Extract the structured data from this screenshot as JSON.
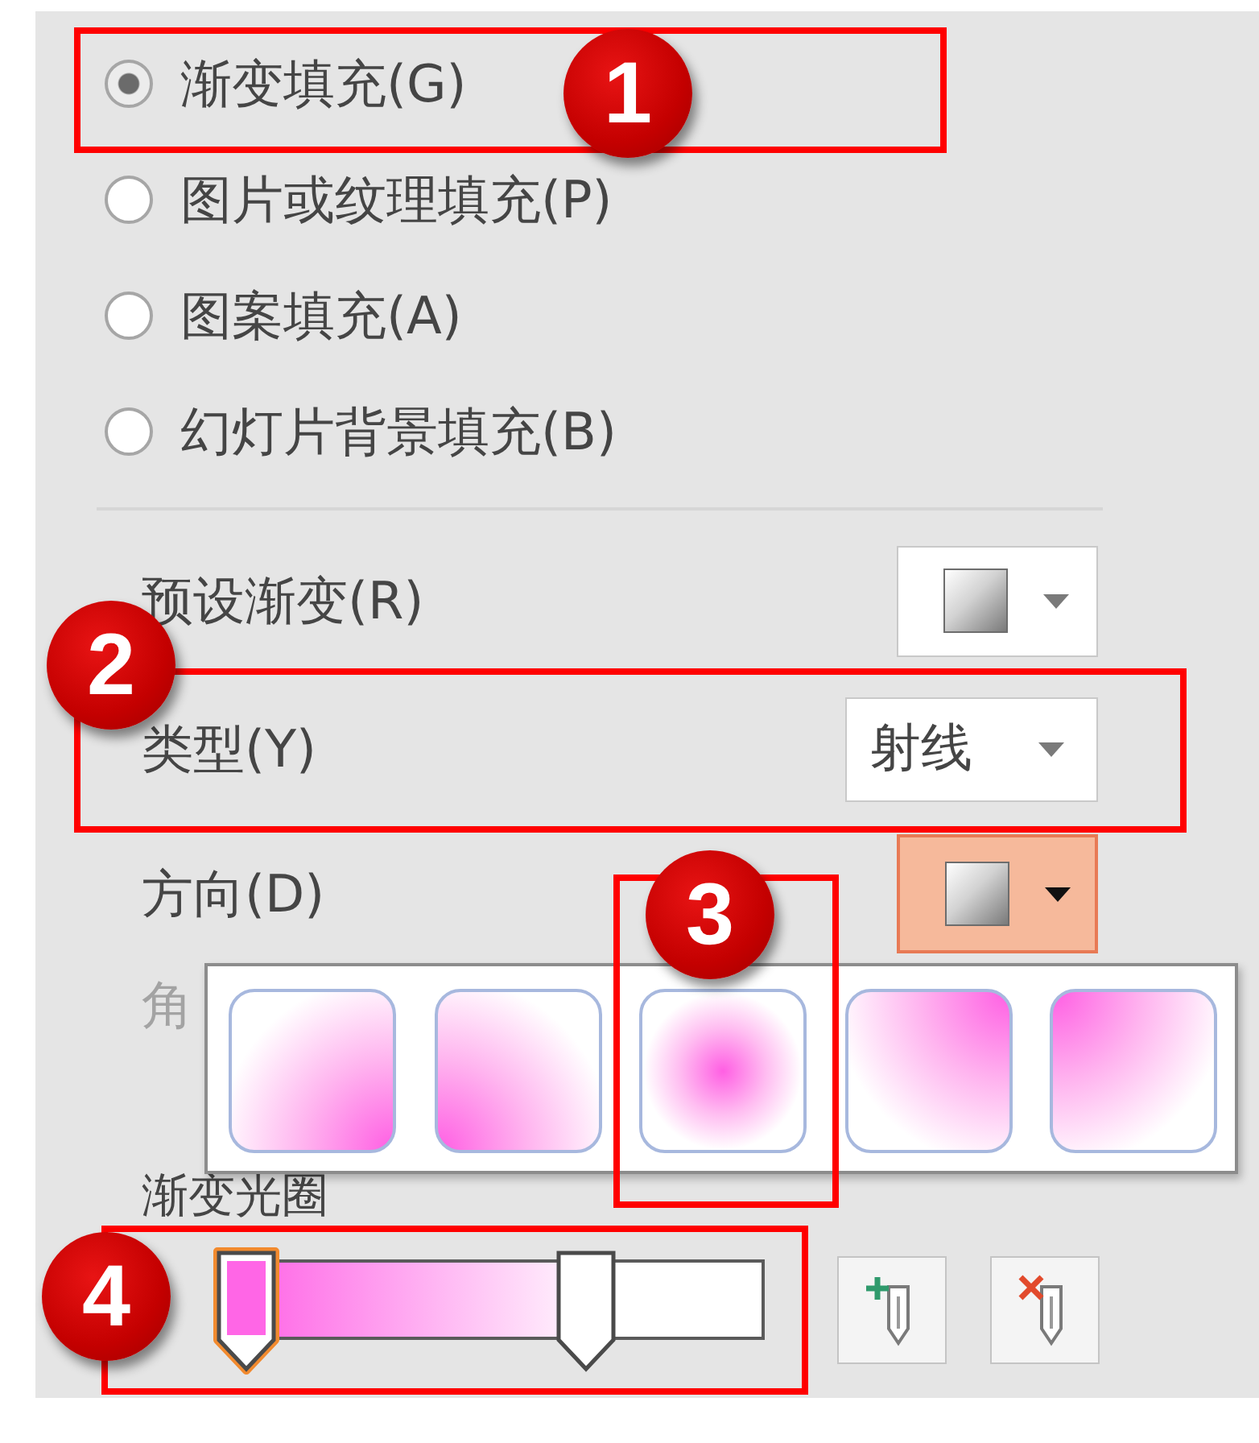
{
  "fill_options": [
    {
      "label": "渐变填充(G)",
      "selected": true
    },
    {
      "label": "图片或纹理填充(P)",
      "selected": false
    },
    {
      "label": "图案填充(A)",
      "selected": false
    },
    {
      "label": "幻灯片背景填充(B)",
      "selected": false
    }
  ],
  "preset_gradient": {
    "label": "预设渐变(R)"
  },
  "type": {
    "label": "类型(Y)",
    "value": "射线"
  },
  "direction": {
    "label": "方向(D)",
    "open": true,
    "options": [
      {
        "kind": "bottomright"
      },
      {
        "kind": "bottomleft"
      },
      {
        "kind": "center"
      },
      {
        "kind": "topright"
      },
      {
        "kind": "topleft"
      }
    ]
  },
  "angle": {
    "label": "角",
    "disabled": true
  },
  "gradient_stops": {
    "label": "渐变光圈",
    "stops": [
      {
        "level": 0,
        "color": "#ff66e6",
        "selected": true
      },
      {
        "level": 0.7,
        "color": "#ffffff",
        "selected": false
      }
    ],
    "buttons": [
      {
        "kind": "add"
      },
      {
        "kind": "remove"
      }
    ]
  },
  "callouts": [
    {
      "number": "1"
    },
    {
      "number": "2"
    },
    {
      "number": "3"
    },
    {
      "number": "4"
    }
  ]
}
